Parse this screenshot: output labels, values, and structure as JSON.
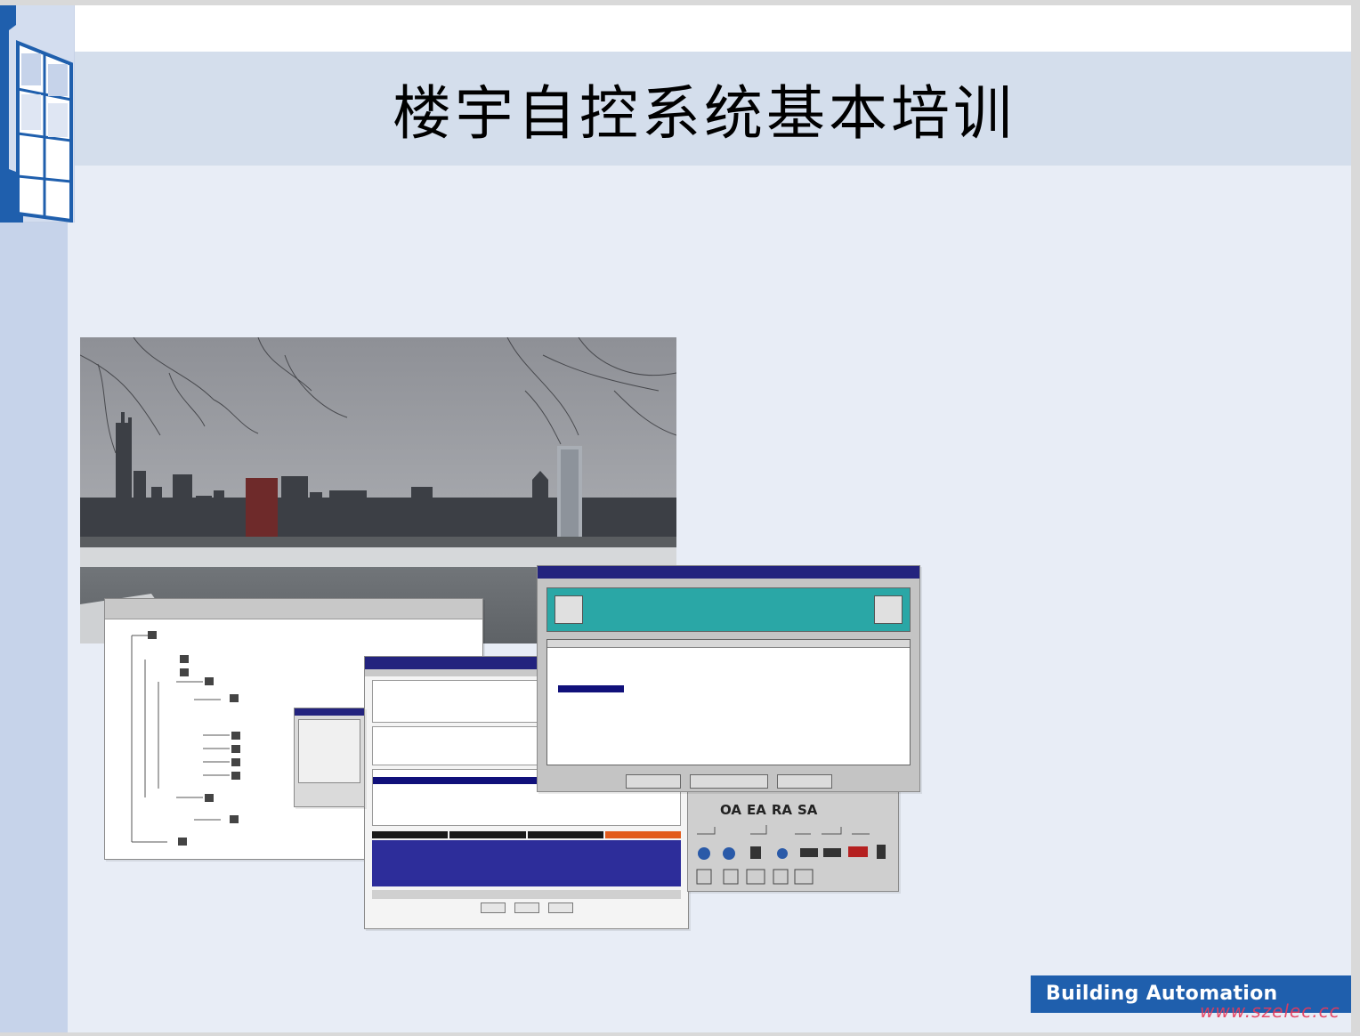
{
  "slide": {
    "title": "楼宇自控系统基本培训",
    "badge_label": "Building Automation",
    "watermark": "www.szelec.cc"
  },
  "colors": {
    "slide_background": "#e8edf6",
    "title_band": "#d4deec",
    "left_band": "#c6d3ea",
    "badge": "#1f5fad",
    "logo_blue": "#1f5fad",
    "watermark": "#e83a5a"
  },
  "collage": {
    "photo": "city-skyline-photo",
    "screenshots": [
      "tree-view-window",
      "multi-loader-window",
      "communication-status-window",
      "symbol-palette-window"
    ],
    "palette_labels": [
      "OA",
      "EA",
      "RA",
      "SA"
    ]
  }
}
